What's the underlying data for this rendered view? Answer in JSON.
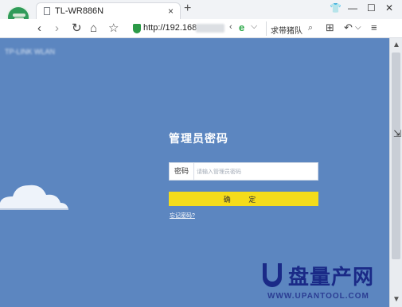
{
  "tab": {
    "title": "TL-WR886N",
    "close": "×",
    "new_tab": "+"
  },
  "window": {
    "shirt": "👕",
    "minimize": "—",
    "restore": "☐",
    "close": "✕"
  },
  "nav": {
    "back": "‹",
    "forward": "›",
    "reload": "↻",
    "home": "⌂",
    "star": "☆"
  },
  "address": {
    "url": "http://192.168",
    "share": "‹",
    "e": "e",
    "caret": "⌵"
  },
  "search": {
    "text": "求带猪队",
    "icon": "⌕"
  },
  "toolbar": {
    "apps": "⊞",
    "undo": "↶",
    "undo_caret": "⌵",
    "menu": "≡"
  },
  "page": {
    "blurred_top_text": "TP-LINK WLAN",
    "login_title": "管理员密码",
    "password_label": "密码",
    "password_placeholder": "请输入管理员密码",
    "confirm_button": "确 定",
    "forgot_link": "忘记密码?"
  },
  "watermark": {
    "brand": "盘量产网",
    "url": "WWW.UPANTOOL.COM"
  },
  "colors": {
    "page_bg": "#5c86c0",
    "button": "#f4dc1b",
    "watermark": "#1a2a87"
  },
  "icons": [
    "browser-logo-icon",
    "document-icon",
    "shield-icon",
    "e-icon",
    "search-icon",
    "apps-icon",
    "undo-icon",
    "menu-icon",
    "cloud-icon"
  ]
}
